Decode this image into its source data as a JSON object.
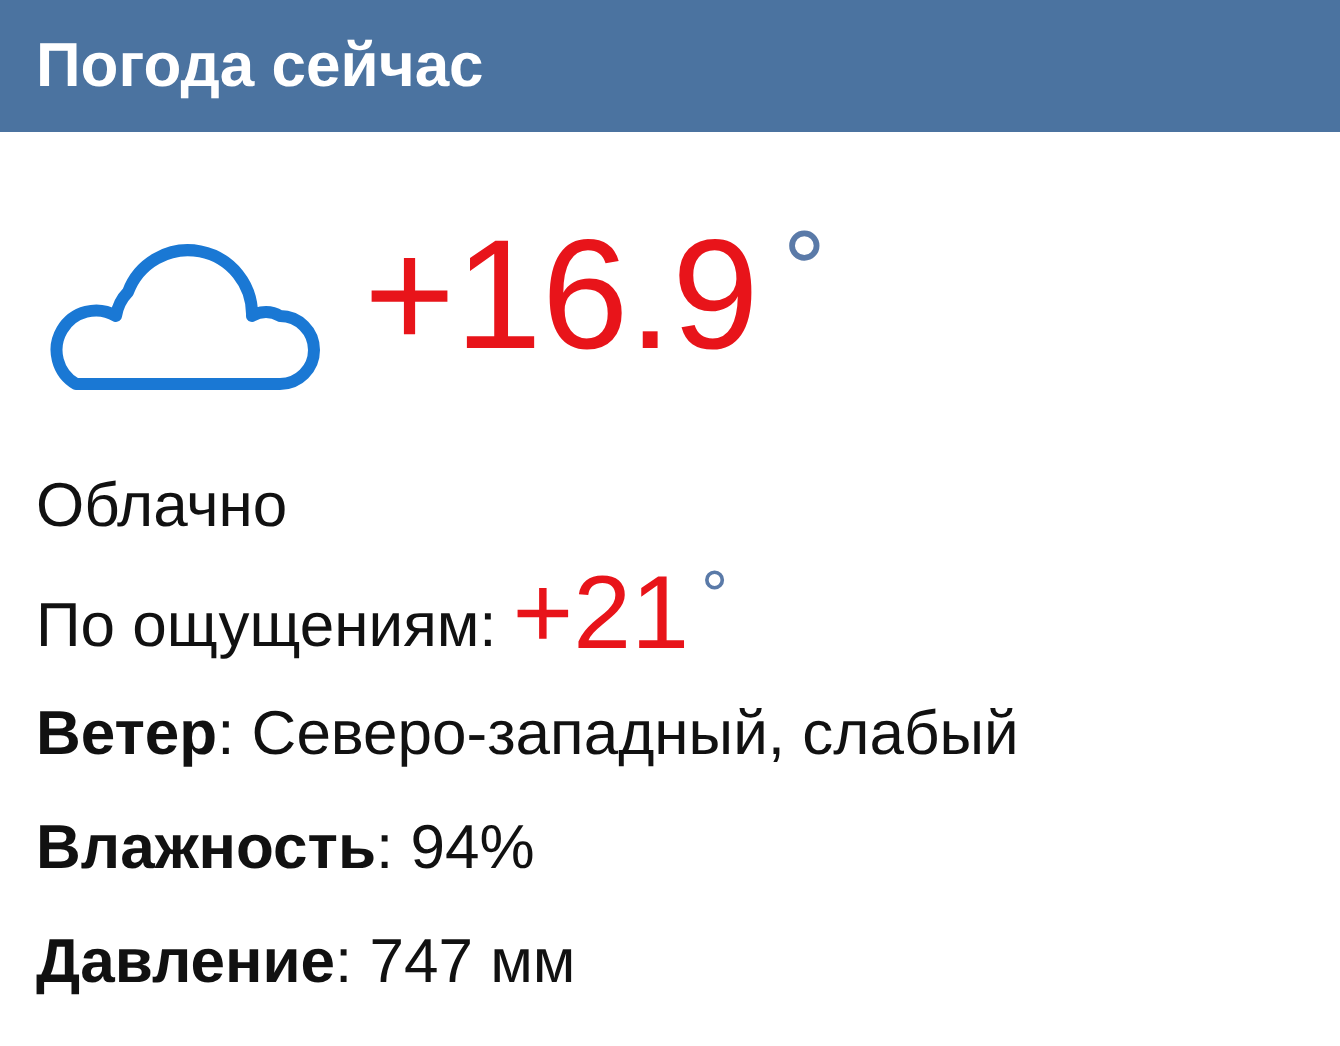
{
  "header": {
    "title": "Погода сейчас"
  },
  "current": {
    "temperature": "+16.9",
    "unit": "°",
    "condition": "Облачно"
  },
  "feels_like": {
    "label": "По ощущениям:",
    "temperature": "+21",
    "unit": "°"
  },
  "details": [
    "**Ветер**: Северо-западный, слабый",
    "**Влажность**: 94%",
    "**Давление**: 747 мм"
  ]
}
